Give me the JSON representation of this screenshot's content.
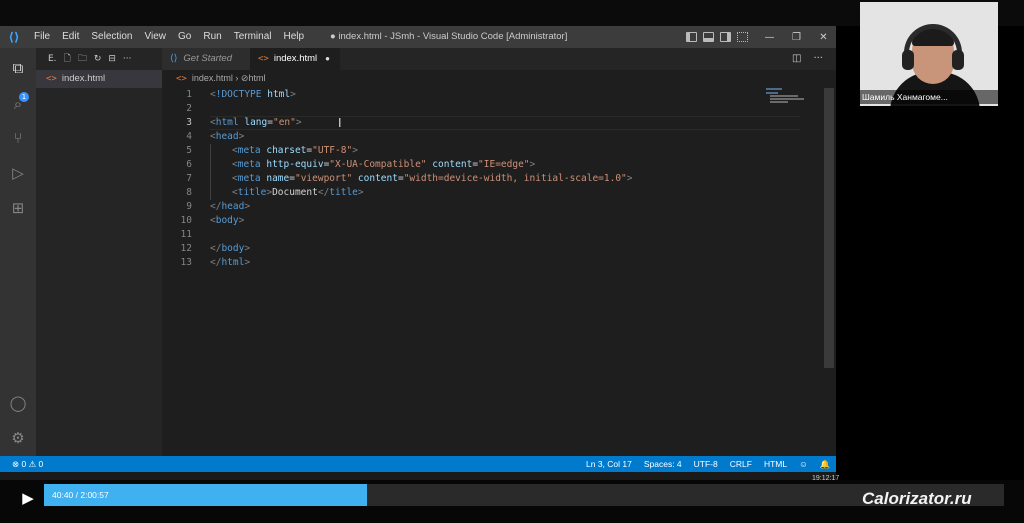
{
  "titlebar": {
    "menu": [
      "File",
      "Edit",
      "Selection",
      "View",
      "Go",
      "Run",
      "Terminal",
      "Help"
    ],
    "window_title": "● index.html - JSmh - Visual Studio Code [Administrator]"
  },
  "explorer": {
    "toolbar_label": "E.",
    "files": [
      {
        "name": "index.html",
        "icon": "html-file-icon"
      }
    ]
  },
  "activity_bar": {
    "badge_count": "1",
    "icons": [
      "files-icon",
      "search-icon",
      "source-control-icon",
      "run-debug-icon",
      "extensions-icon",
      "account-icon",
      "settings-gear-icon"
    ]
  },
  "editor": {
    "tabs": [
      {
        "label": "Get Started",
        "active": false
      },
      {
        "label": "index.html",
        "active": true,
        "dirty": true
      }
    ],
    "breadcrumb": [
      "index.html",
      "html"
    ],
    "code_lines": [
      "<!DOCTYPE html>",
      "",
      "<html lang=\"en\">",
      "<head>",
      "    <meta charset=\"UTF-8\">",
      "    <meta http-equiv=\"X-UA-Compatible\" content=\"IE=edge\">",
      "    <meta name=\"viewport\" content=\"width=device-width, initial-scale=1.0\">",
      "    <title>Document</title>",
      "</head>",
      "<body>",
      "",
      "</body>",
      "</html>"
    ],
    "active_line": 3
  },
  "statusbar": {
    "problems": "⊗ 0 ⚠ 0",
    "position": "Ln 3, Col 17",
    "spaces": "Spaces: 4",
    "encoding": "UTF-8",
    "eol": "CRLF",
    "language": "HTML"
  },
  "player": {
    "time": "40:40 / 2:00:57",
    "progress": 0.3365,
    "clock": "19:12:17",
    "watermark": "Calorizator.ru"
  },
  "webcam": {
    "name": "Шамиль Ханмагоме..."
  },
  "colors": {
    "accent": "#007acc",
    "progress": "#3fb0f0"
  }
}
